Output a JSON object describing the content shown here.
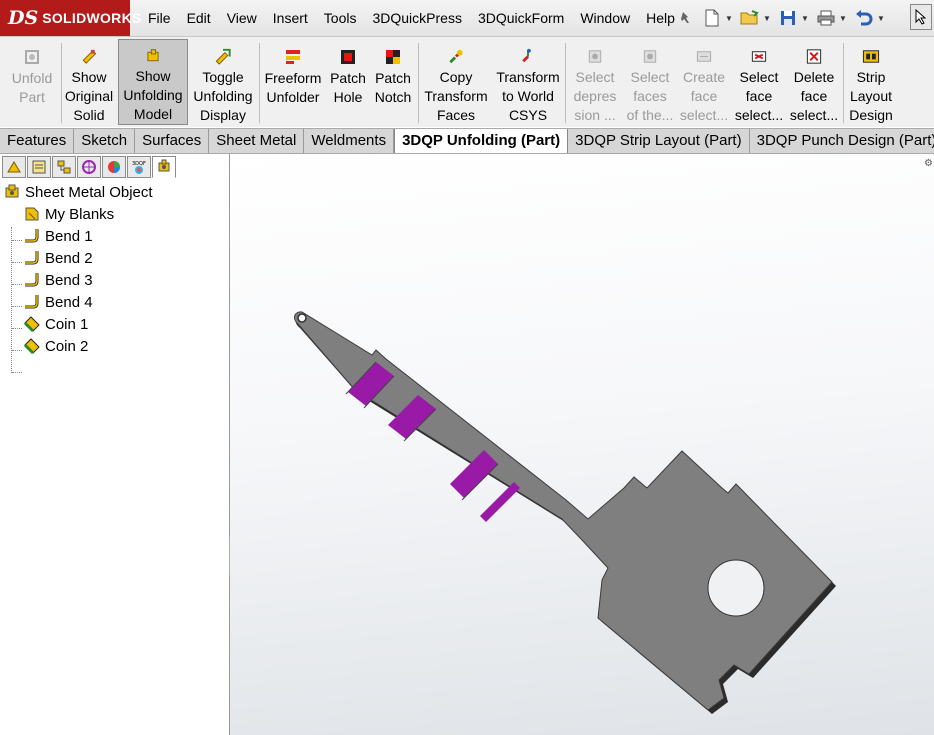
{
  "app": {
    "brand": "SOLIDWORKS",
    "brand_prefix": "DS"
  },
  "menu": [
    "File",
    "Edit",
    "View",
    "Insert",
    "Tools",
    "3DQuickPress",
    "3DQuickForm",
    "Window",
    "Help"
  ],
  "ribbon": {
    "unfold_part": "Unfold\nPart",
    "show_original_solid": "Show\nOriginal\nSolid",
    "show_unfolding_model": "Show\nUnfolding\nModel",
    "toggle_unfolding_display": "Toggle\nUnfolding\nDisplay",
    "freeform_unfolder": "Freeform\nUnfolder",
    "patch_hole": "Patch\nHole",
    "patch_notch": "Patch\nNotch",
    "copy_transform_faces": "Copy\nTransform\nFaces",
    "transform_world_csys": "Transform\nto World\nCSYS",
    "select_depression": "Select\ndepres\nsion ...",
    "select_faces": "Select\nfaces\nof the...",
    "create_face": "Create\nface\nselect...",
    "select_face": "Select\nface\nselect...",
    "delete_face": "Delete\nface\nselect...",
    "strip_layout_design": "Strip\nLayout\nDesign"
  },
  "tabs": [
    "Features",
    "Sketch",
    "Surfaces",
    "Sheet Metal",
    "Weldments",
    "3DQP Unfolding (Part)",
    "3DQP Strip Layout (Part)",
    "3DQP Punch Design (Part)"
  ],
  "active_tab": "3DQP Unfolding (Part)",
  "tree": {
    "root": "Sheet Metal Object",
    "items": [
      "My Blanks",
      "Bend 1",
      "Bend 2",
      "Bend 3",
      "Bend 4",
      "Coin 1",
      "Coin 2"
    ]
  },
  "colors": {
    "part_fill": "#7f7f7f",
    "bend_fill": "#9a1aa8",
    "logo_bg": "#b31b1b"
  }
}
